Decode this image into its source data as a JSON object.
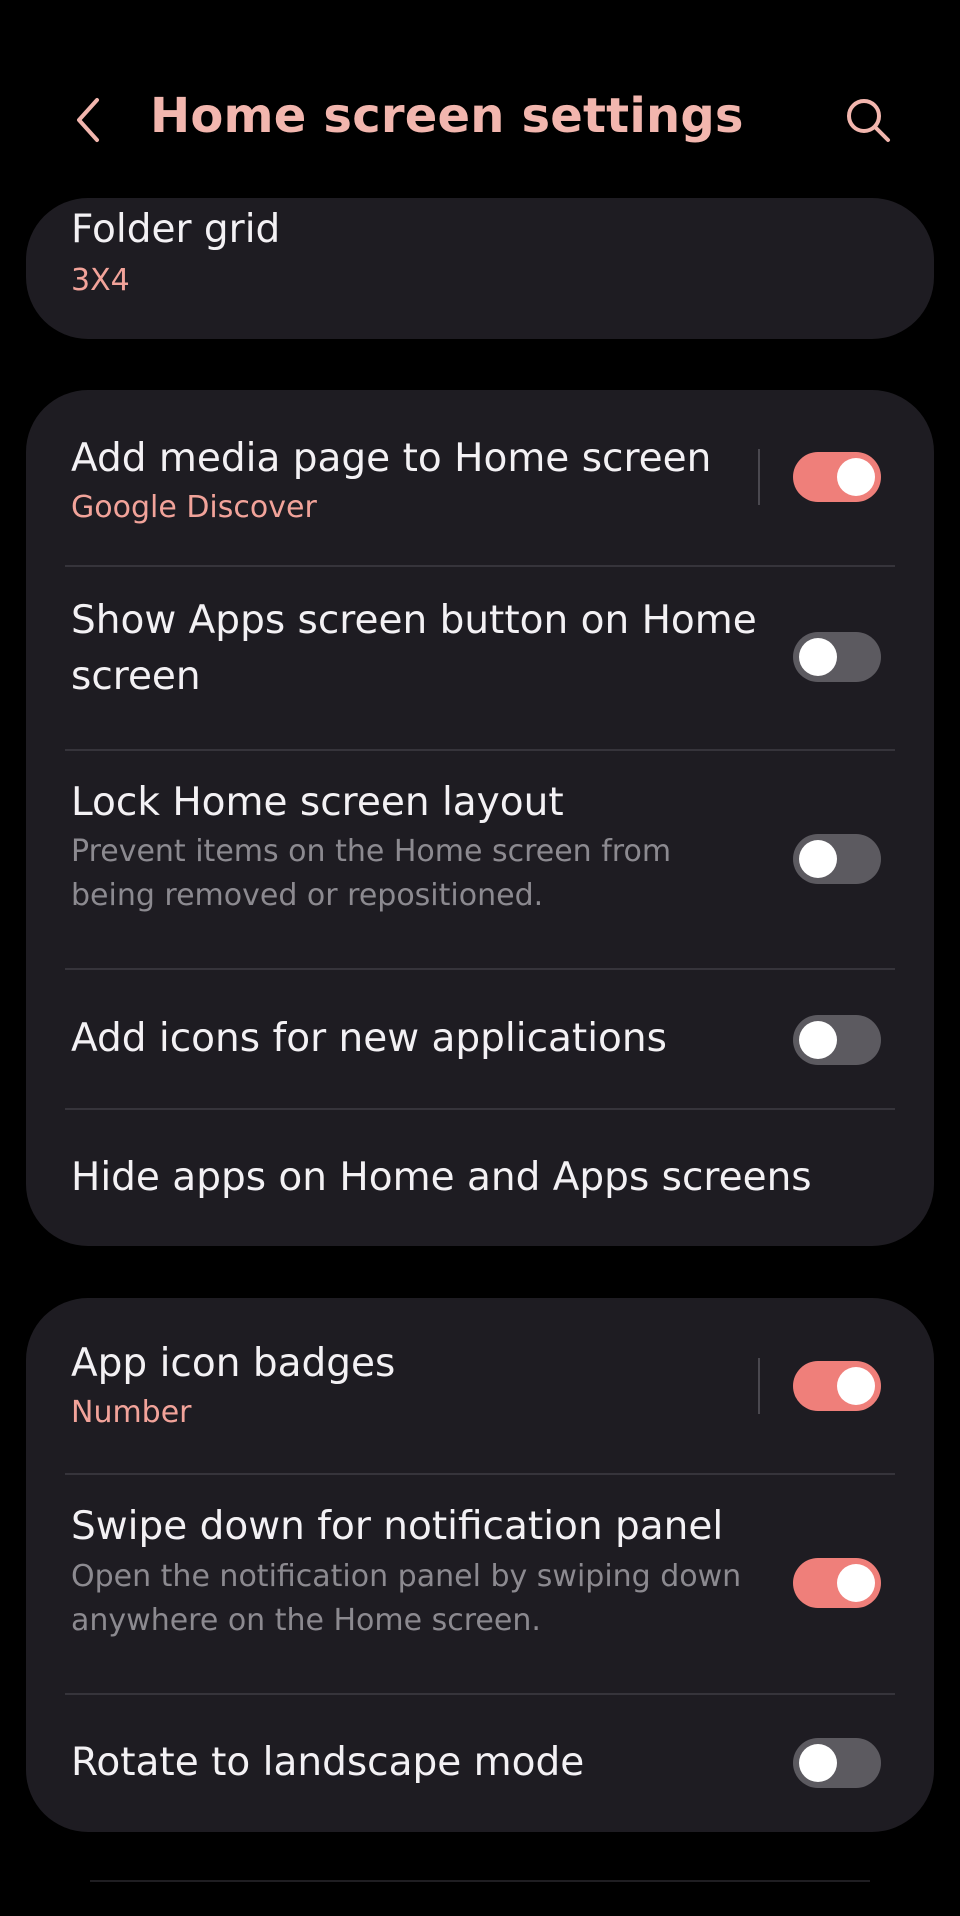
{
  "header": {
    "title": "Home screen settings",
    "back_icon": "chevron-left-icon",
    "search_icon": "search-icon"
  },
  "colors": {
    "accent": "#f2b6ae",
    "toggle_on": "#ef7f7a",
    "toggle_off": "#5c5a60",
    "card_bg": "#1e1c22",
    "background": "#000000"
  },
  "folder_grid": {
    "title": "Folder grid",
    "value": "3X4"
  },
  "group1": {
    "media_page": {
      "title": "Add media page to Home screen",
      "subtitle": "Google Discover",
      "enabled": true
    },
    "apps_button": {
      "title_line1": "Show Apps screen button on Home",
      "title_line2": "screen",
      "enabled": false
    },
    "lock_layout": {
      "title": "Lock Home screen layout",
      "desc_line1": "Prevent items on the Home screen from",
      "desc_line2": "being removed or repositioned.",
      "enabled": false
    },
    "add_icons": {
      "title": "Add icons for new applications",
      "enabled": false
    },
    "hide_apps": {
      "title": "Hide apps on Home and Apps screens"
    }
  },
  "group2": {
    "badges": {
      "title": "App icon badges",
      "subtitle": "Number",
      "enabled": true
    },
    "swipe_down": {
      "title": "Swipe down for notification panel",
      "desc_line1": "Open the notification panel by swiping down",
      "desc_line2": "anywhere on the Home screen.",
      "enabled": true
    },
    "rotate": {
      "title": "Rotate to landscape mode",
      "enabled": false
    }
  }
}
